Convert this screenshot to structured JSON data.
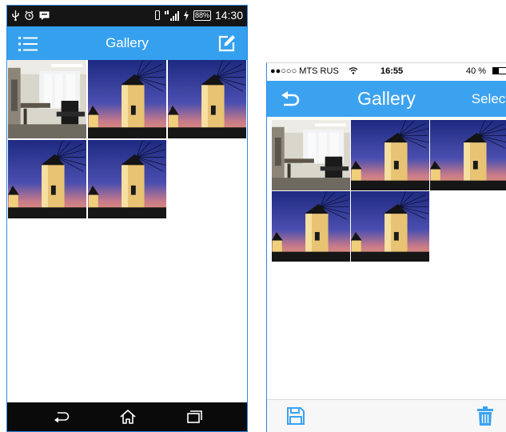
{
  "android": {
    "status_bar": {
      "battery": "88%",
      "time": "14:30",
      "icons": [
        "usb-icon",
        "alarm-icon",
        "notification-icon",
        "vibrate-icon",
        "signal-icon",
        "charging-icon"
      ]
    },
    "app_bar": {
      "title": "Gallery",
      "menu_icon": "list-menu-icon",
      "edit_icon": "edit-icon"
    },
    "gallery": {
      "photos": [
        {
          "kind": "office"
        },
        {
          "kind": "windmill"
        },
        {
          "kind": "windmill"
        },
        {
          "kind": "windmill"
        },
        {
          "kind": "windmill"
        }
      ]
    },
    "nav_bar": {
      "buttons": [
        "back-icon",
        "home-icon",
        "recent-apps-icon"
      ]
    }
  },
  "ios": {
    "status_bar": {
      "carrier": "●●○○○ MTS RUS",
      "time": "16:55",
      "battery": "40 %",
      "battery_level": 0.4
    },
    "nav_bar": {
      "title": "Gallery",
      "select_label": "Select",
      "back_icon": "back-arrow-icon"
    },
    "gallery": {
      "photos": [
        {
          "kind": "office"
        },
        {
          "kind": "windmill"
        },
        {
          "kind": "windmill"
        },
        {
          "kind": "windmill"
        },
        {
          "kind": "windmill"
        }
      ]
    },
    "toolbar": {
      "left_icon": "save-icon",
      "right_icon": "trash-icon"
    }
  },
  "colors": {
    "accent": "#35a0ee",
    "frame_border": "#2f89e0",
    "android_status": "#151515"
  }
}
